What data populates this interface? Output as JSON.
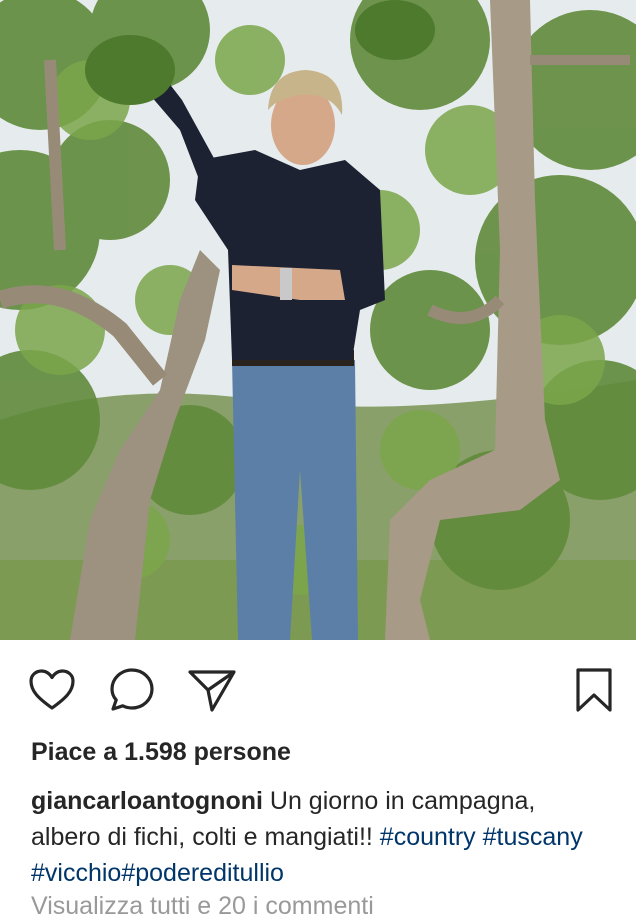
{
  "post": {
    "image_alt": "Man in a dark shirt and jeans standing in a fig tree picking figs"
  },
  "actions": {
    "like_icon": "heart-icon",
    "comment_icon": "comment-icon",
    "share_icon": "send-icon",
    "save_icon": "bookmark-icon"
  },
  "likes": {
    "text": "Piace a 1.598 persone"
  },
  "caption": {
    "username": "giancarloantognoni",
    "text": "Un giorno in campagna, albero di fichi, colti e mangiati!!",
    "hashtags": [
      "#country",
      "#tuscany",
      "#vicchio",
      "#podereditullio"
    ]
  },
  "comments": {
    "link": "Visualizza tutti e 20 i commenti"
  },
  "colors": {
    "text": "#262626",
    "hashtag": "#003569",
    "muted": "#999999"
  }
}
